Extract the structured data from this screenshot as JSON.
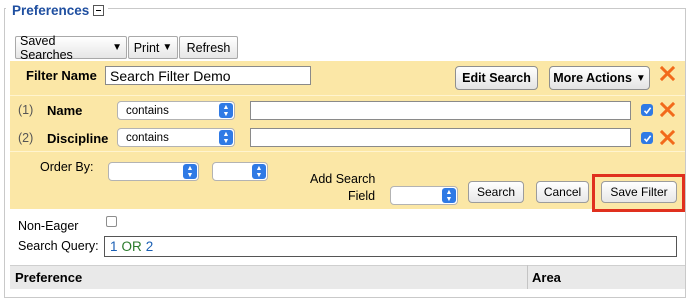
{
  "section": {
    "title": "Preferences"
  },
  "toolbar": {
    "saved_searches": "Saved Searches",
    "print": "Print",
    "refresh": "Refresh"
  },
  "filter": {
    "name_label": "Filter Name",
    "name_value": "Search Filter Demo",
    "edit_search": "Edit Search",
    "more_actions": "More Actions"
  },
  "criteria": [
    {
      "index": "(1)",
      "field": "Name",
      "operator": "contains",
      "value": "",
      "checked": true
    },
    {
      "index": "(2)",
      "field": "Discipline",
      "operator": "contains",
      "value": "",
      "checked": true
    }
  ],
  "order": {
    "label": "Order By:",
    "field_value": "",
    "direction_value": ""
  },
  "add_field": {
    "label_line1": "Add Search",
    "label_line2": "Field",
    "value": ""
  },
  "actions": {
    "search": "Search",
    "cancel": "Cancel",
    "save_filter": "Save Filter"
  },
  "non_eager": {
    "label": "Non-Eager",
    "checked": false
  },
  "search_query": {
    "label": "Search Query:",
    "term1": "1",
    "operator": "OR",
    "term2": "2"
  },
  "table": {
    "columns": [
      "Preference",
      "Area"
    ]
  },
  "colors": {
    "panel_bg": "#fbe7a6",
    "title_blue": "#1f4fa0",
    "delete_orange": "#f26a1b",
    "highlight_red": "#e0301e",
    "select_blue": "#2f7ae5"
  }
}
